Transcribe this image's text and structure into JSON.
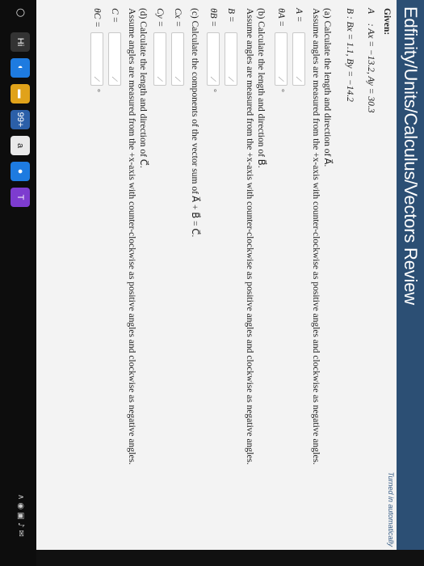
{
  "header": {
    "title": "Edfinity/Units/Calculus/Vectors Review"
  },
  "status": {
    "turned_in": "Turned in automatically"
  },
  "given": {
    "label": "Given:",
    "a_line": "A⃗ : Ax = −13.2, Ay = 30.3",
    "b_line": "B : Bx = 1.1, By = −14.2"
  },
  "part_a": {
    "line1": "(a) Calculate the length and direction of A⃗.",
    "line2": "Assume angles are measured from the +x-axis with counter-clockwise as positive angles and clockwise as negative angles.",
    "len_label": "A =",
    "angle_label": "θA =",
    "len_value": "",
    "angle_value": "",
    "unit": "°"
  },
  "part_b": {
    "line1": "(b) Calculate the length and direction of B⃗.",
    "line2": "Assume angles are measured from the +x-axis with counter-clockwise as positive angles and clockwise as negative angles.",
    "len_label": "B =",
    "angle_label": "θB =",
    "len_value": "",
    "angle_value": "",
    "unit": "°"
  },
  "part_c": {
    "line1": "(c) Calculate the components of the vector sum of A⃗ + B⃗ = C⃗.",
    "cx_label": "Cx =",
    "cy_label": "Cy =",
    "cx_value": "",
    "cy_value": ""
  },
  "part_d": {
    "line1": "(d) Calculate the length and direction of C⃗.",
    "line2": "Assume angles are measured from the +x-axis with counter-clockwise as positive angles and clockwise as negative angles.",
    "len_label": "C =",
    "angle_label": "θC =",
    "len_value": "",
    "angle_value": "",
    "unit": "°"
  },
  "taskbar": {
    "start_icon": "circle-icon",
    "apps": [
      "Hi",
      "99+",
      "a"
    ]
  }
}
